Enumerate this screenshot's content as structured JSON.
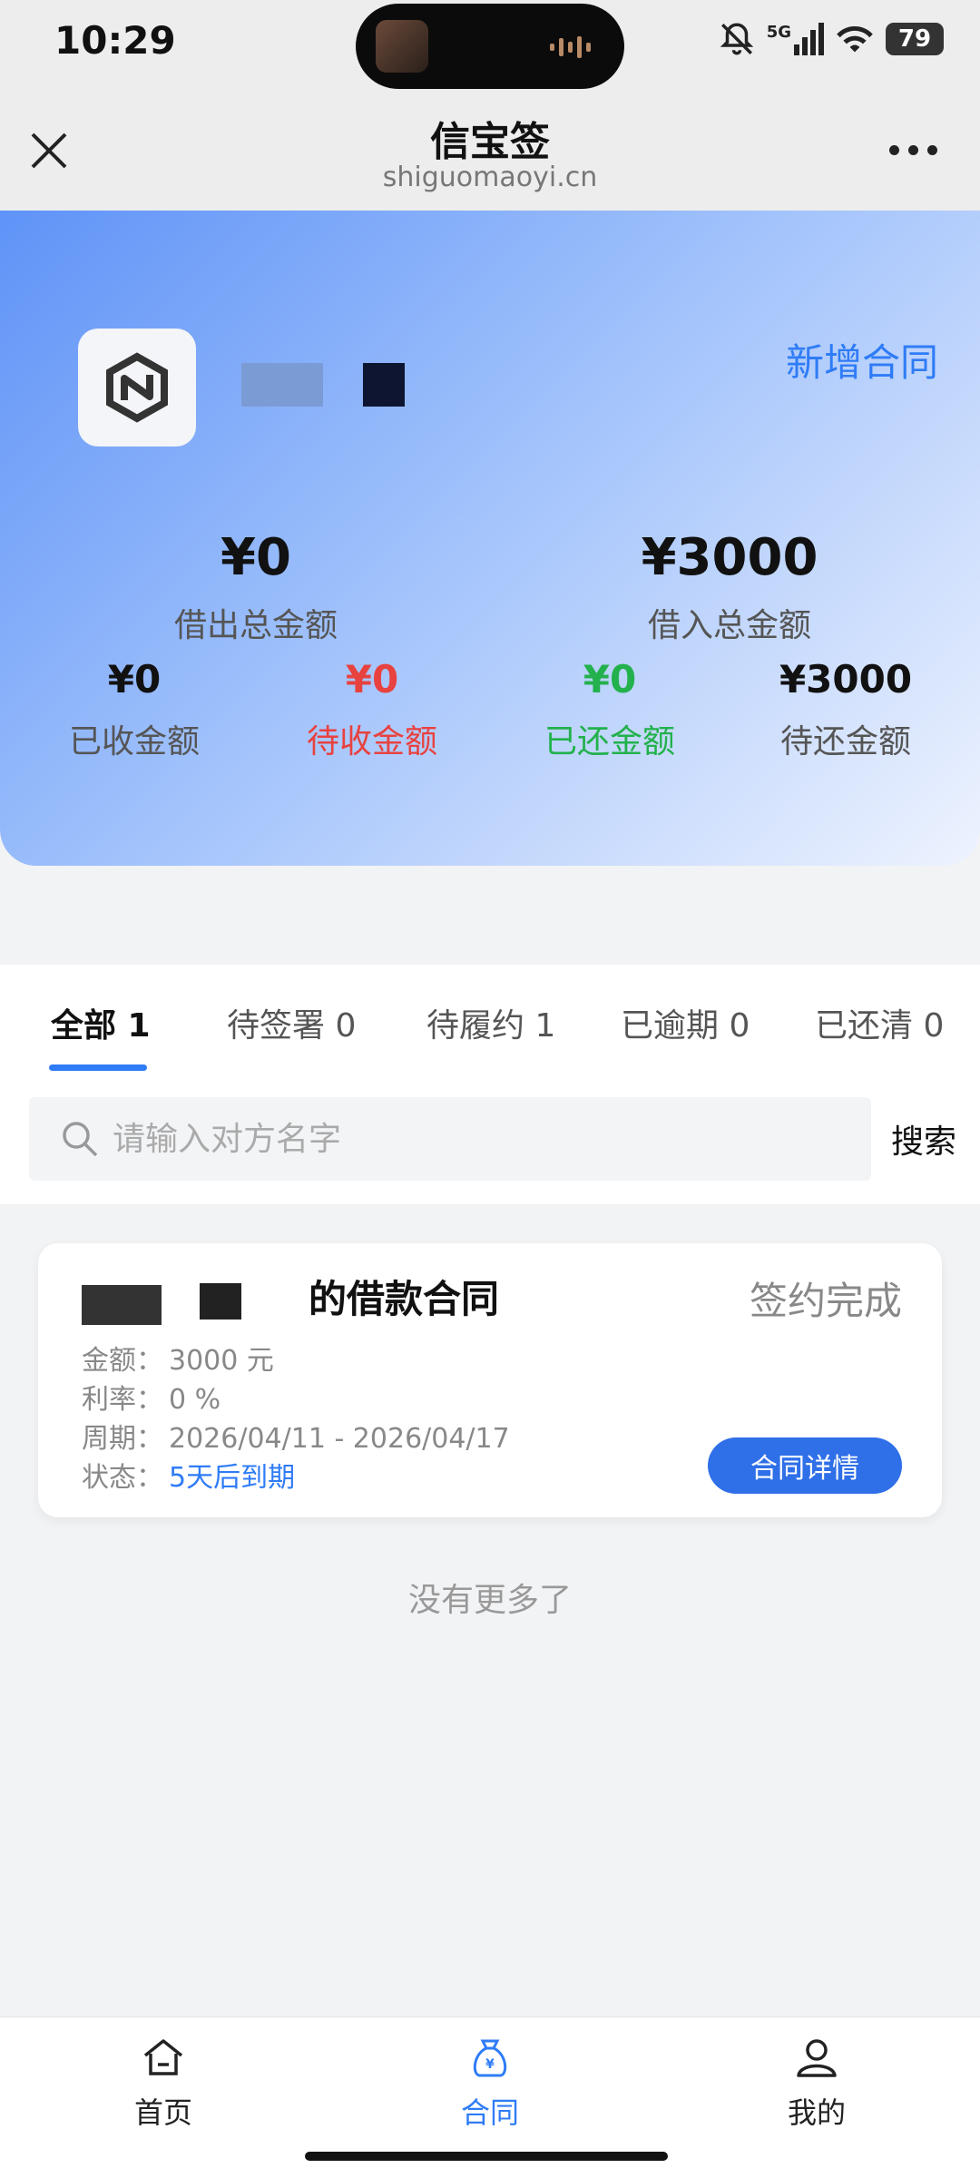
{
  "status_bar": {
    "time": "10:29",
    "battery": "79",
    "network": "5G"
  },
  "header": {
    "title": "信宝签",
    "domain": "shiguomaoyi.cn"
  },
  "hero": {
    "add_contract": "新增合同",
    "lent_total_amount": "¥0",
    "lent_total_label": "借出总金额",
    "borrowed_total_amount": "¥3000",
    "borrowed_total_label": "借入总金额",
    "stats": [
      {
        "amount": "¥0",
        "label": "已收金额",
        "color": "#555555"
      },
      {
        "amount": "¥0",
        "label": "待收金额",
        "color": "#e8423f"
      },
      {
        "amount": "¥0",
        "label": "已还金额",
        "color": "#22b14c"
      },
      {
        "amount": "¥3000",
        "label": "待还金额",
        "color": "#555555"
      }
    ]
  },
  "tabs": [
    {
      "label": "全部 1",
      "active": true
    },
    {
      "label": "待签署 0",
      "active": false
    },
    {
      "label": "待履约 1",
      "active": false
    },
    {
      "label": "已逾期 0",
      "active": false
    },
    {
      "label": "已还清 0",
      "active": false
    }
  ],
  "search": {
    "placeholder": "请输入对方名字",
    "button": "搜索"
  },
  "contract_card": {
    "title": "的借款合同",
    "status": "签约完成",
    "amount_label": "金额：",
    "amount_value": "3000 元",
    "rate_label": "利率：",
    "rate_value": "0 %",
    "period_label": "周期：",
    "period_value": "2026/04/11 - 2026/04/17",
    "state_label": "状态：",
    "state_value": "5天后到期",
    "detail_button": "合同详情"
  },
  "list_footer": "没有更多了",
  "bottom_nav": [
    {
      "label": "首页",
      "icon": "home-icon",
      "active": false
    },
    {
      "label": "合同",
      "icon": "money-bag-icon",
      "active": true
    },
    {
      "label": "我的",
      "icon": "user-icon",
      "active": false
    }
  ],
  "colors": {
    "accent": "#2f7cf6",
    "red": "#e8423f",
    "green": "#22b14c"
  }
}
